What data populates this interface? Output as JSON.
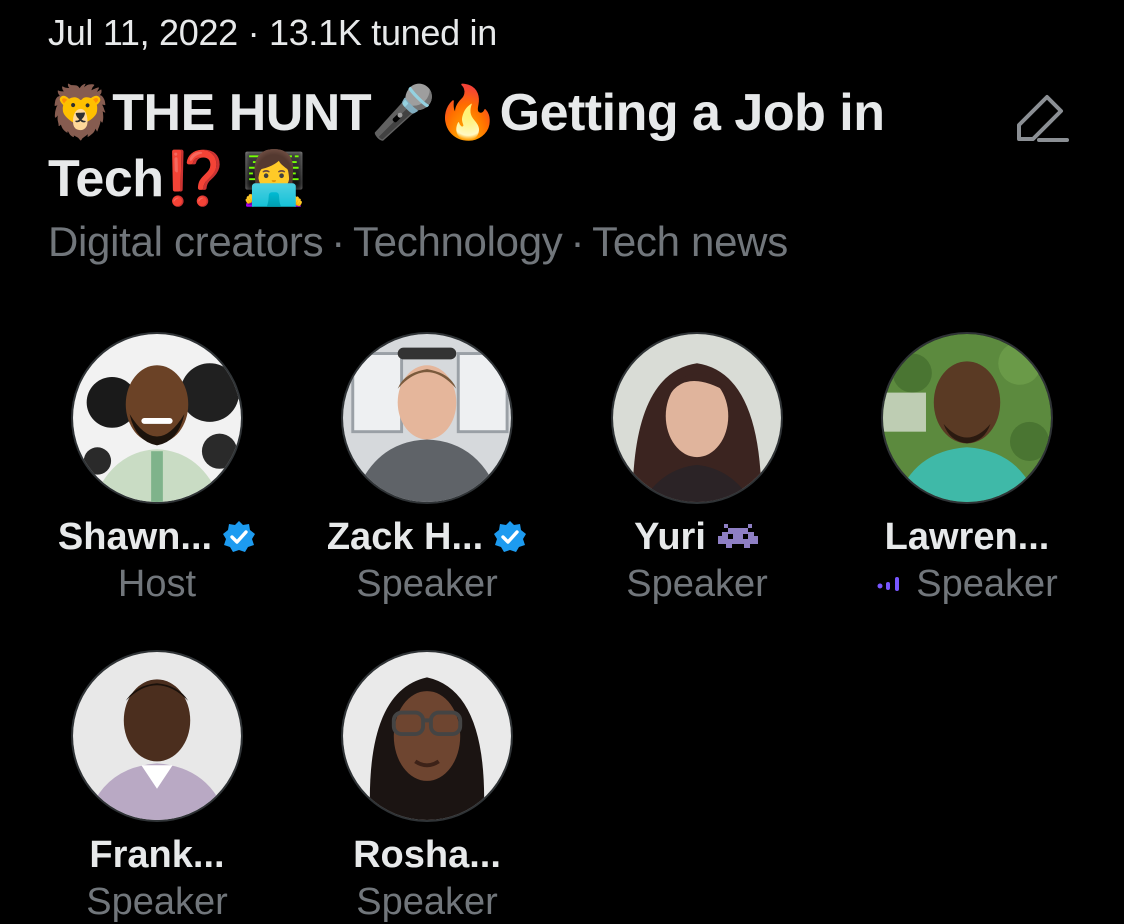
{
  "header": {
    "meta": "Jul 11, 2022 · 13.1K tuned in",
    "title_part1": "THE HUNT",
    "title_part2": "Getting a Job in",
    "title_part3": "Tech",
    "title_marks": "⁉️",
    "edit_icon": "pencil-icon"
  },
  "topics": [
    "Digital creators",
    "Technology",
    "Tech news"
  ],
  "topic_separator": "·",
  "colors": {
    "background": "#000000",
    "primary_text": "#e7e9ea",
    "secondary_text": "#71767b",
    "verified_blue": "#1d9bf0",
    "speaking_purple": "#7856ff"
  },
  "participants": [
    {
      "name": "Shawn...",
      "role": "Host",
      "verified": true
    },
    {
      "name": "Zack H...",
      "role": "Speaker",
      "verified": true
    },
    {
      "name": "Yuri",
      "role": "Speaker",
      "verified": false,
      "badge_icon": "alien-monster-icon"
    },
    {
      "name": "Lawren...",
      "role": "Speaker",
      "verified": false,
      "speaking_icon": "speaking-bars-icon"
    },
    {
      "name": "Frank...",
      "role": "Speaker",
      "verified": false
    },
    {
      "name": "Rosha...",
      "role": "Speaker",
      "verified": false
    }
  ]
}
